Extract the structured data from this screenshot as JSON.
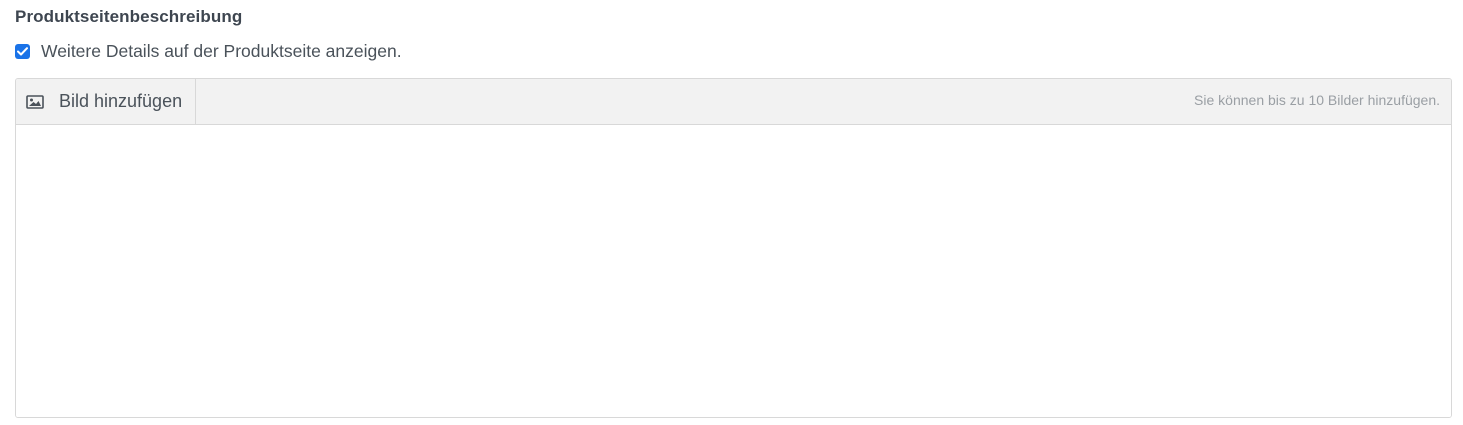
{
  "section": {
    "title": "Produktseitenbeschreibung"
  },
  "checkbox": {
    "label": "Weitere Details auf der Produktseite anzeigen.",
    "checked": true,
    "color": "#1a73e8"
  },
  "editor": {
    "toolbar": {
      "add_image_label": "Bild hinzufügen",
      "add_image_icon": "image-icon",
      "hint": "Sie können bis zu 10 Bilder hinzufügen."
    },
    "content": ""
  }
}
